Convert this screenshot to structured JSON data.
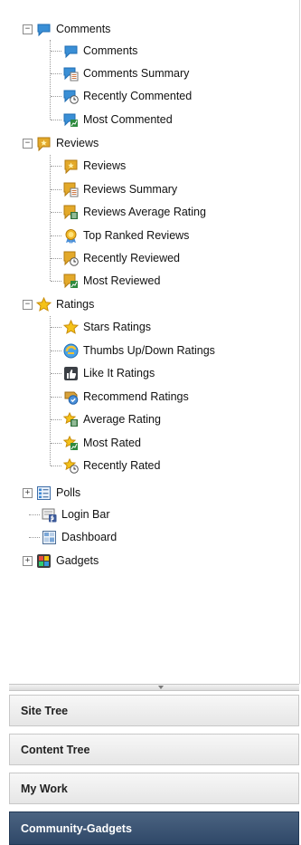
{
  "tree": {
    "comments": {
      "label": "Comments",
      "children": [
        "Comments",
        "Comments Summary",
        "Recently Commented",
        "Most Commented"
      ]
    },
    "reviews": {
      "label": "Reviews",
      "children": [
        "Reviews",
        "Reviews Summary",
        "Reviews Average Rating",
        "Top Ranked Reviews",
        "Recently Reviewed",
        "Most Reviewed"
      ]
    },
    "ratings": {
      "label": "Ratings",
      "children": [
        "Stars Ratings",
        "Thumbs Up/Down Ratings",
        "Like It Ratings",
        "Recommend Ratings",
        "Average Rating",
        "Most Rated",
        "Recently Rated"
      ]
    },
    "polls": {
      "label": "Polls"
    },
    "login_bar": {
      "label": "Login Bar"
    },
    "dashboard": {
      "label": "Dashboard"
    },
    "gadgets": {
      "label": "Gadgets"
    },
    "expanded_symbol": "−",
    "collapsed_symbol": "+"
  },
  "accordion": {
    "site_tree": "Site Tree",
    "content_tree": "Content Tree",
    "my_work": "My Work",
    "community_gadgets": "Community-Gadgets"
  },
  "colors": {
    "active_panel": "#3a5475",
    "comment_blue": "#3a8fd6",
    "review_gold": "#e3a92a",
    "star_yellow": "#f4c21a"
  }
}
